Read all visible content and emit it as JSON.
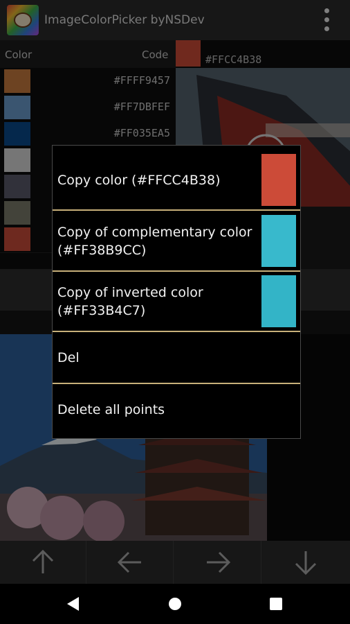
{
  "app": {
    "title": "ImageColorPicker byNSDev"
  },
  "list": {
    "header_color": "Color",
    "header_code": "Code",
    "rows": [
      {
        "color": "#c67a3f",
        "code": "#FFFF9457"
      },
      {
        "color": "#6a9ccd",
        "code": "#FF7DBFEF"
      },
      {
        "color": "#0a4a8a",
        "code": "#FF035EA5"
      },
      {
        "color": "#d8d8d8",
        "code": ""
      },
      {
        "color": "#5a5a6a",
        "code": ""
      },
      {
        "color": "#7a7a6a",
        "code": ""
      },
      {
        "color": "#c84b3a",
        "code": ""
      }
    ]
  },
  "selected": {
    "color": "#CC4B38",
    "code": "#FFCC4B38"
  },
  "menu": {
    "copy_color": "Copy color (#FFCC4B38)",
    "copy_color_swatch": "#CC4B38",
    "copy_complementary": "Copy of complementary color (#FF38B9CC)",
    "copy_complementary_swatch": "#38B9CC",
    "copy_inverted": "Copy of inverted color (#FF33B4C7)",
    "copy_inverted_swatch": "#33B4C7",
    "del": "Del",
    "delete_all": "Delete all points"
  },
  "nav_icons": [
    "arrow-up-icon",
    "arrow-left-icon",
    "arrow-right-icon",
    "arrow-down-icon"
  ],
  "system_nav": [
    "back-icon",
    "home-icon",
    "recents-icon"
  ]
}
